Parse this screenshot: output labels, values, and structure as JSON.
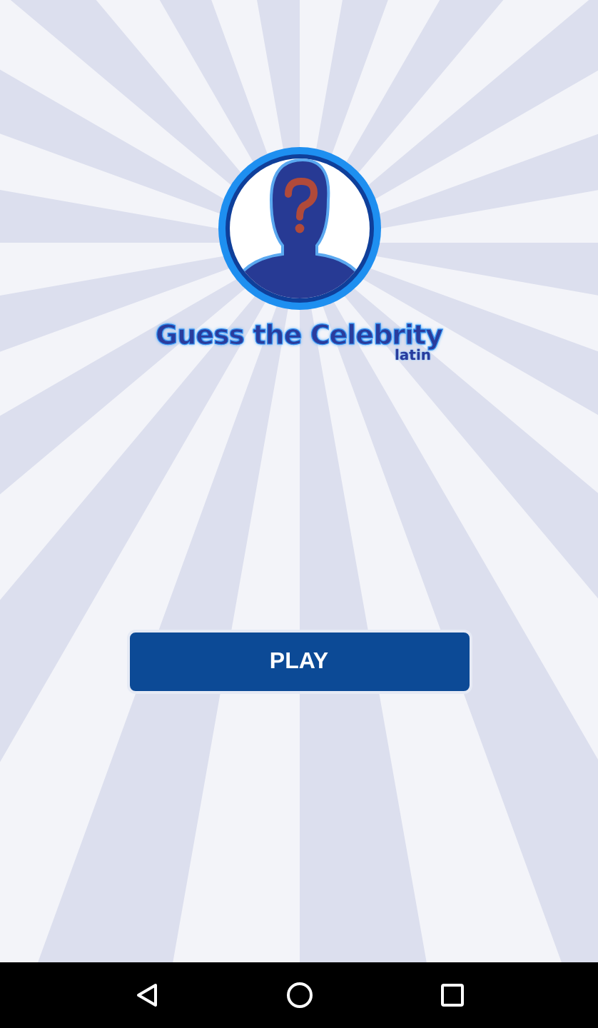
{
  "logo": {
    "title": "Guess the Celebrity",
    "subtitle": "latin"
  },
  "play_button": {
    "label": "PLAY"
  }
}
